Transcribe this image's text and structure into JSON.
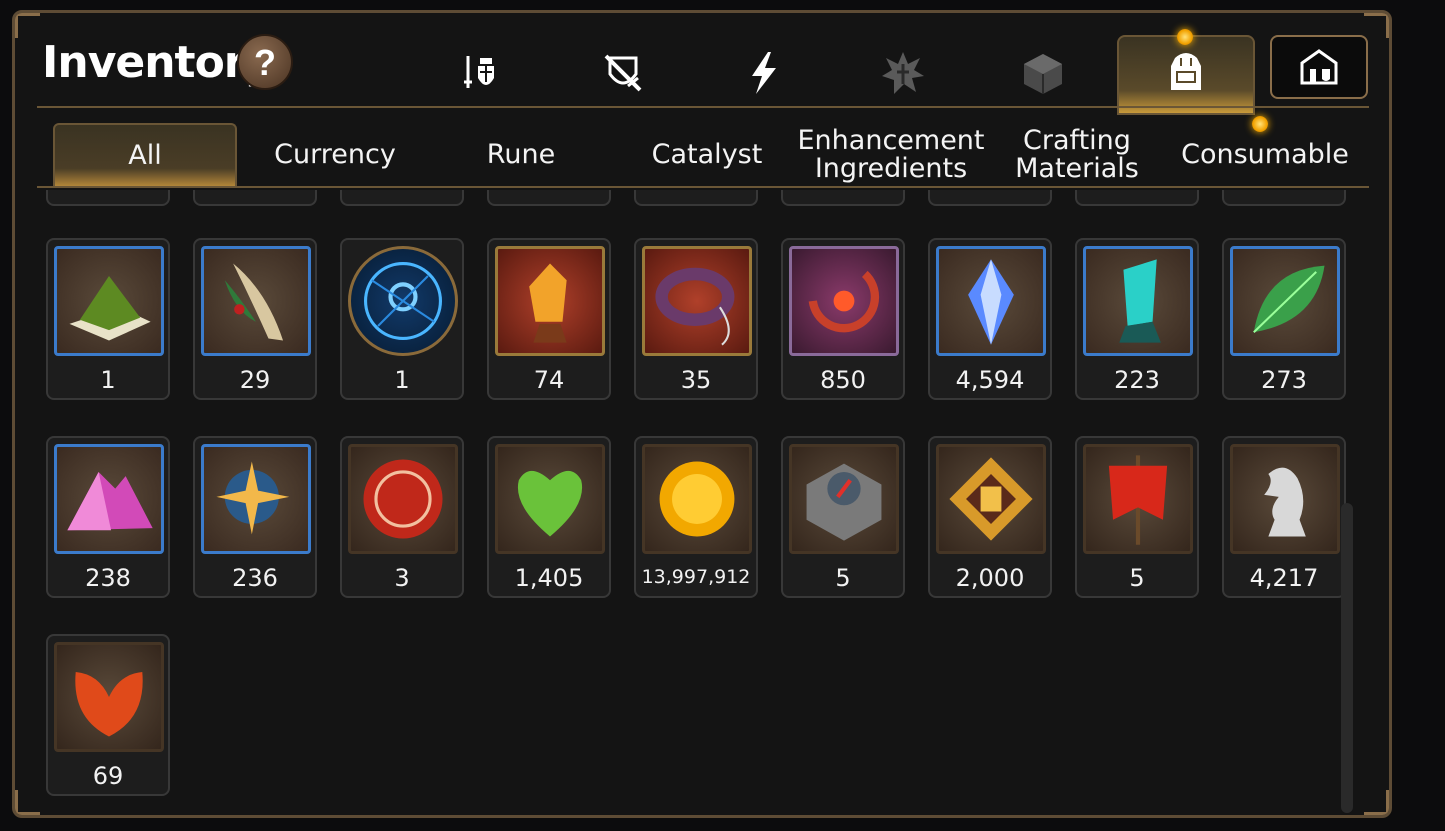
{
  "header": {
    "title": "Inventory",
    "help_label": "?"
  },
  "category_icons": [
    {
      "name": "gear-knight-icon",
      "active": false
    },
    {
      "name": "shield-swords-icon",
      "active": false
    },
    {
      "name": "lightning-icon",
      "active": false
    },
    {
      "name": "rune-burst-icon",
      "active": false
    },
    {
      "name": "cube-icon",
      "active": false
    },
    {
      "name": "backpack-icon",
      "active": true
    }
  ],
  "home_button_icon": "castle-icon",
  "tabs": [
    {
      "label": "All",
      "active": true
    },
    {
      "label": "Currency",
      "active": false
    },
    {
      "label": "Rune",
      "active": false
    },
    {
      "label": "Catalyst",
      "active": false
    },
    {
      "label": "Enhancement\nIngredients",
      "active": false
    },
    {
      "label": "Crafting\nMaterials",
      "active": false
    },
    {
      "label": "Consumable",
      "active": false
    }
  ],
  "items": [
    {
      "name": "green-powder-item",
      "count": "1"
    },
    {
      "name": "herb-root-item",
      "count": "29"
    },
    {
      "name": "blue-emblem-item",
      "count": "1"
    },
    {
      "name": "amber-crystal-item",
      "count": "74"
    },
    {
      "name": "rune-ring-item",
      "count": "35"
    },
    {
      "name": "red-flower-ring-item",
      "count": "850"
    },
    {
      "name": "blue-gem-item",
      "count": "4,594"
    },
    {
      "name": "teal-crystal-item",
      "count": "223"
    },
    {
      "name": "green-leaf-item",
      "count": "273"
    },
    {
      "name": "pink-ore-item",
      "count": "238"
    },
    {
      "name": "star-amulet-item",
      "count": "236"
    },
    {
      "name": "red-seal-item",
      "count": "3"
    },
    {
      "name": "green-heart-item",
      "count": "1,405"
    },
    {
      "name": "gold-coin-item",
      "count": "13,997,912"
    },
    {
      "name": "stone-compass-item",
      "count": "5"
    },
    {
      "name": "fist-badge-item",
      "count": "2,000"
    },
    {
      "name": "war-banner-item",
      "count": "5"
    },
    {
      "name": "knight-chess-item",
      "count": "4,217"
    },
    {
      "name": "red-leaf-item",
      "count": "69"
    }
  ],
  "colors": {
    "accent_gold": "#c89a3a",
    "frame_blue": "#3b7bcb",
    "panel_border": "#5e4c35"
  }
}
